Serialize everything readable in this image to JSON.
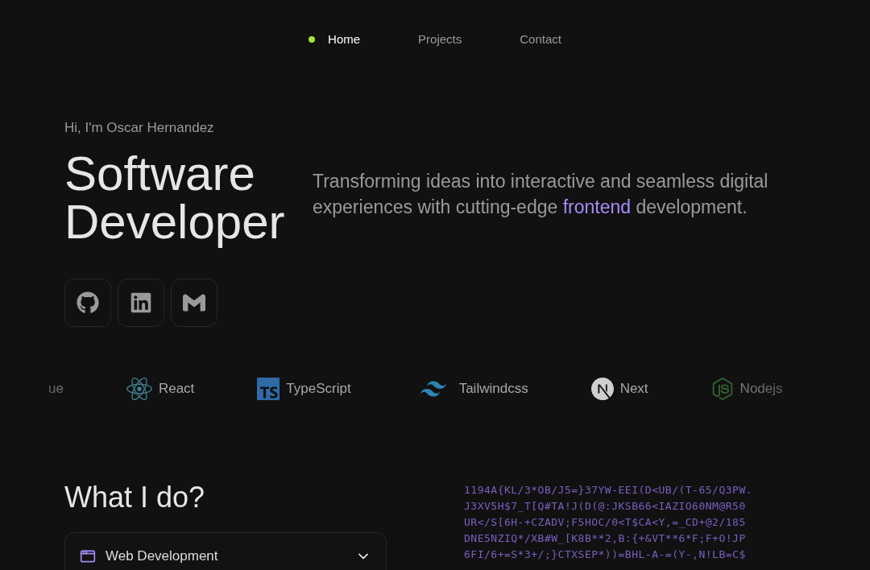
{
  "nav": [
    {
      "label": "Home",
      "selected": true
    },
    {
      "label": "Projects",
      "selected": false
    },
    {
      "label": "Contact",
      "selected": false
    }
  ],
  "hero": {
    "greeting": "Hi, I'm Oscar Hernandez",
    "title_lines": [
      "Software",
      "Developer"
    ],
    "tagline": "Transforming ideas into interactive and seamless digital experiences with cutting-edge *frontend* development."
  },
  "socials": [
    {
      "kind": "github"
    },
    {
      "kind": "linkedin"
    },
    {
      "kind": "mail"
    }
  ],
  "tech": [
    {
      "kind": "text",
      "label": "ue"
    },
    {
      "kind": "react",
      "label": "React"
    },
    {
      "kind": "typescript",
      "label": "TypeScript"
    },
    {
      "kind": "tailwind",
      "label": "Tailwindcss"
    },
    {
      "kind": "next",
      "label": "Next"
    },
    {
      "kind": "node",
      "label": "Nodejs"
    }
  ],
  "services": {
    "title": "What I do?",
    "items": [
      {
        "label": "Web Development",
        "expanded": false
      }
    ]
  },
  "code_rain": [
    "1194A{KL/3*OB/J5=}37YW-EEI(D<UB/(T-65/Q3PW.",
    "J3XV5H$7_T[Q#TA!J(D(@:JKSB66<IAZIO60NM@R50",
    "UR</S[6H-+CZADV;F5HOC/0<T$CA<Y,=_CD+@2/185",
    "DNE5NZIQ*/XB#W_[K8B**2,B:{+&VT**6*F;F+O!JP",
    "6FI/6+=S*3+/;}CTXSEP*))=BHL-A-=(Y-,N!LB=C$"
  ]
}
